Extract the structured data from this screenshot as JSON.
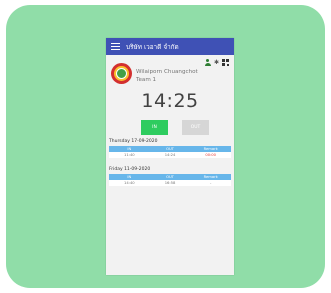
{
  "app": {
    "title": "บริษัท เวอาดี จำกัด"
  },
  "user": {
    "name": "Wilaiporn Chuangchot",
    "team": "Team 1"
  },
  "clock": {
    "time": "14:25"
  },
  "buttons": {
    "in_label": "IN",
    "out_label": "OUT"
  },
  "table_headers": [
    "IN",
    "OUT",
    "Remark"
  ],
  "days": [
    {
      "label": "Thursday 17-09-2020",
      "in": "11:40",
      "out": "14:24",
      "remark": "00:00"
    },
    {
      "label": "Friday 11-09-2020",
      "in": "14:40",
      "out": "16:58",
      "remark": "-"
    }
  ],
  "colors": {
    "background": "#90dda8",
    "app_bar": "#3f51b5",
    "table_header": "#67b6ea",
    "in_button": "#2ecc5f",
    "out_button": "#d6d6d6",
    "remark_late": "#e53935"
  },
  "icons": {
    "menu": "menu-icon",
    "person": "person-icon",
    "bluetooth": "bluetooth-icon",
    "qr": "qr-code-icon"
  }
}
